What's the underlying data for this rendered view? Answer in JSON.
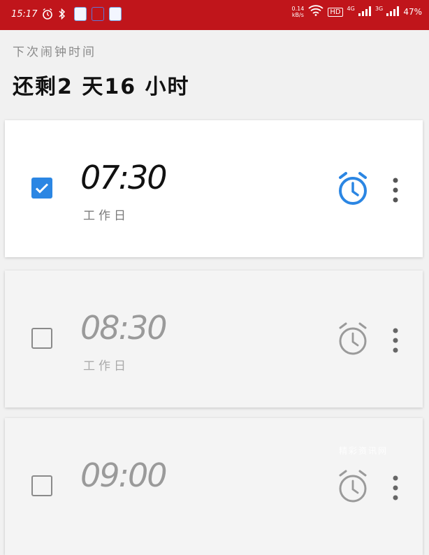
{
  "status_bar": {
    "time": "15:17",
    "net_speed_top": "0.14",
    "net_speed_bottom": "kB/s",
    "hd": "HD",
    "sig1_label": "4G",
    "sig2_label": "3G",
    "battery": "47%",
    "icons": [
      "alarm-icon",
      "bluetooth-icon",
      "app-badge-icon",
      "app-badge-icon",
      "app-badge-icon",
      "wifi-icon",
      "signal-icon",
      "signal-icon"
    ]
  },
  "header": {
    "next_label": "下次闹钟时间",
    "remaining": "还剩2 天16 小时"
  },
  "alarms": [
    {
      "time": "07:30",
      "repeat": "工作日",
      "enabled": true
    },
    {
      "time": "08:30",
      "repeat": "工作日",
      "enabled": false
    },
    {
      "time": "09:00",
      "repeat": "",
      "enabled": false
    }
  ],
  "colors": {
    "status_bar": "#c0151b",
    "accent": "#2b86e3",
    "disabled": "#9a9a9a"
  },
  "watermark": "精彩资讯网"
}
